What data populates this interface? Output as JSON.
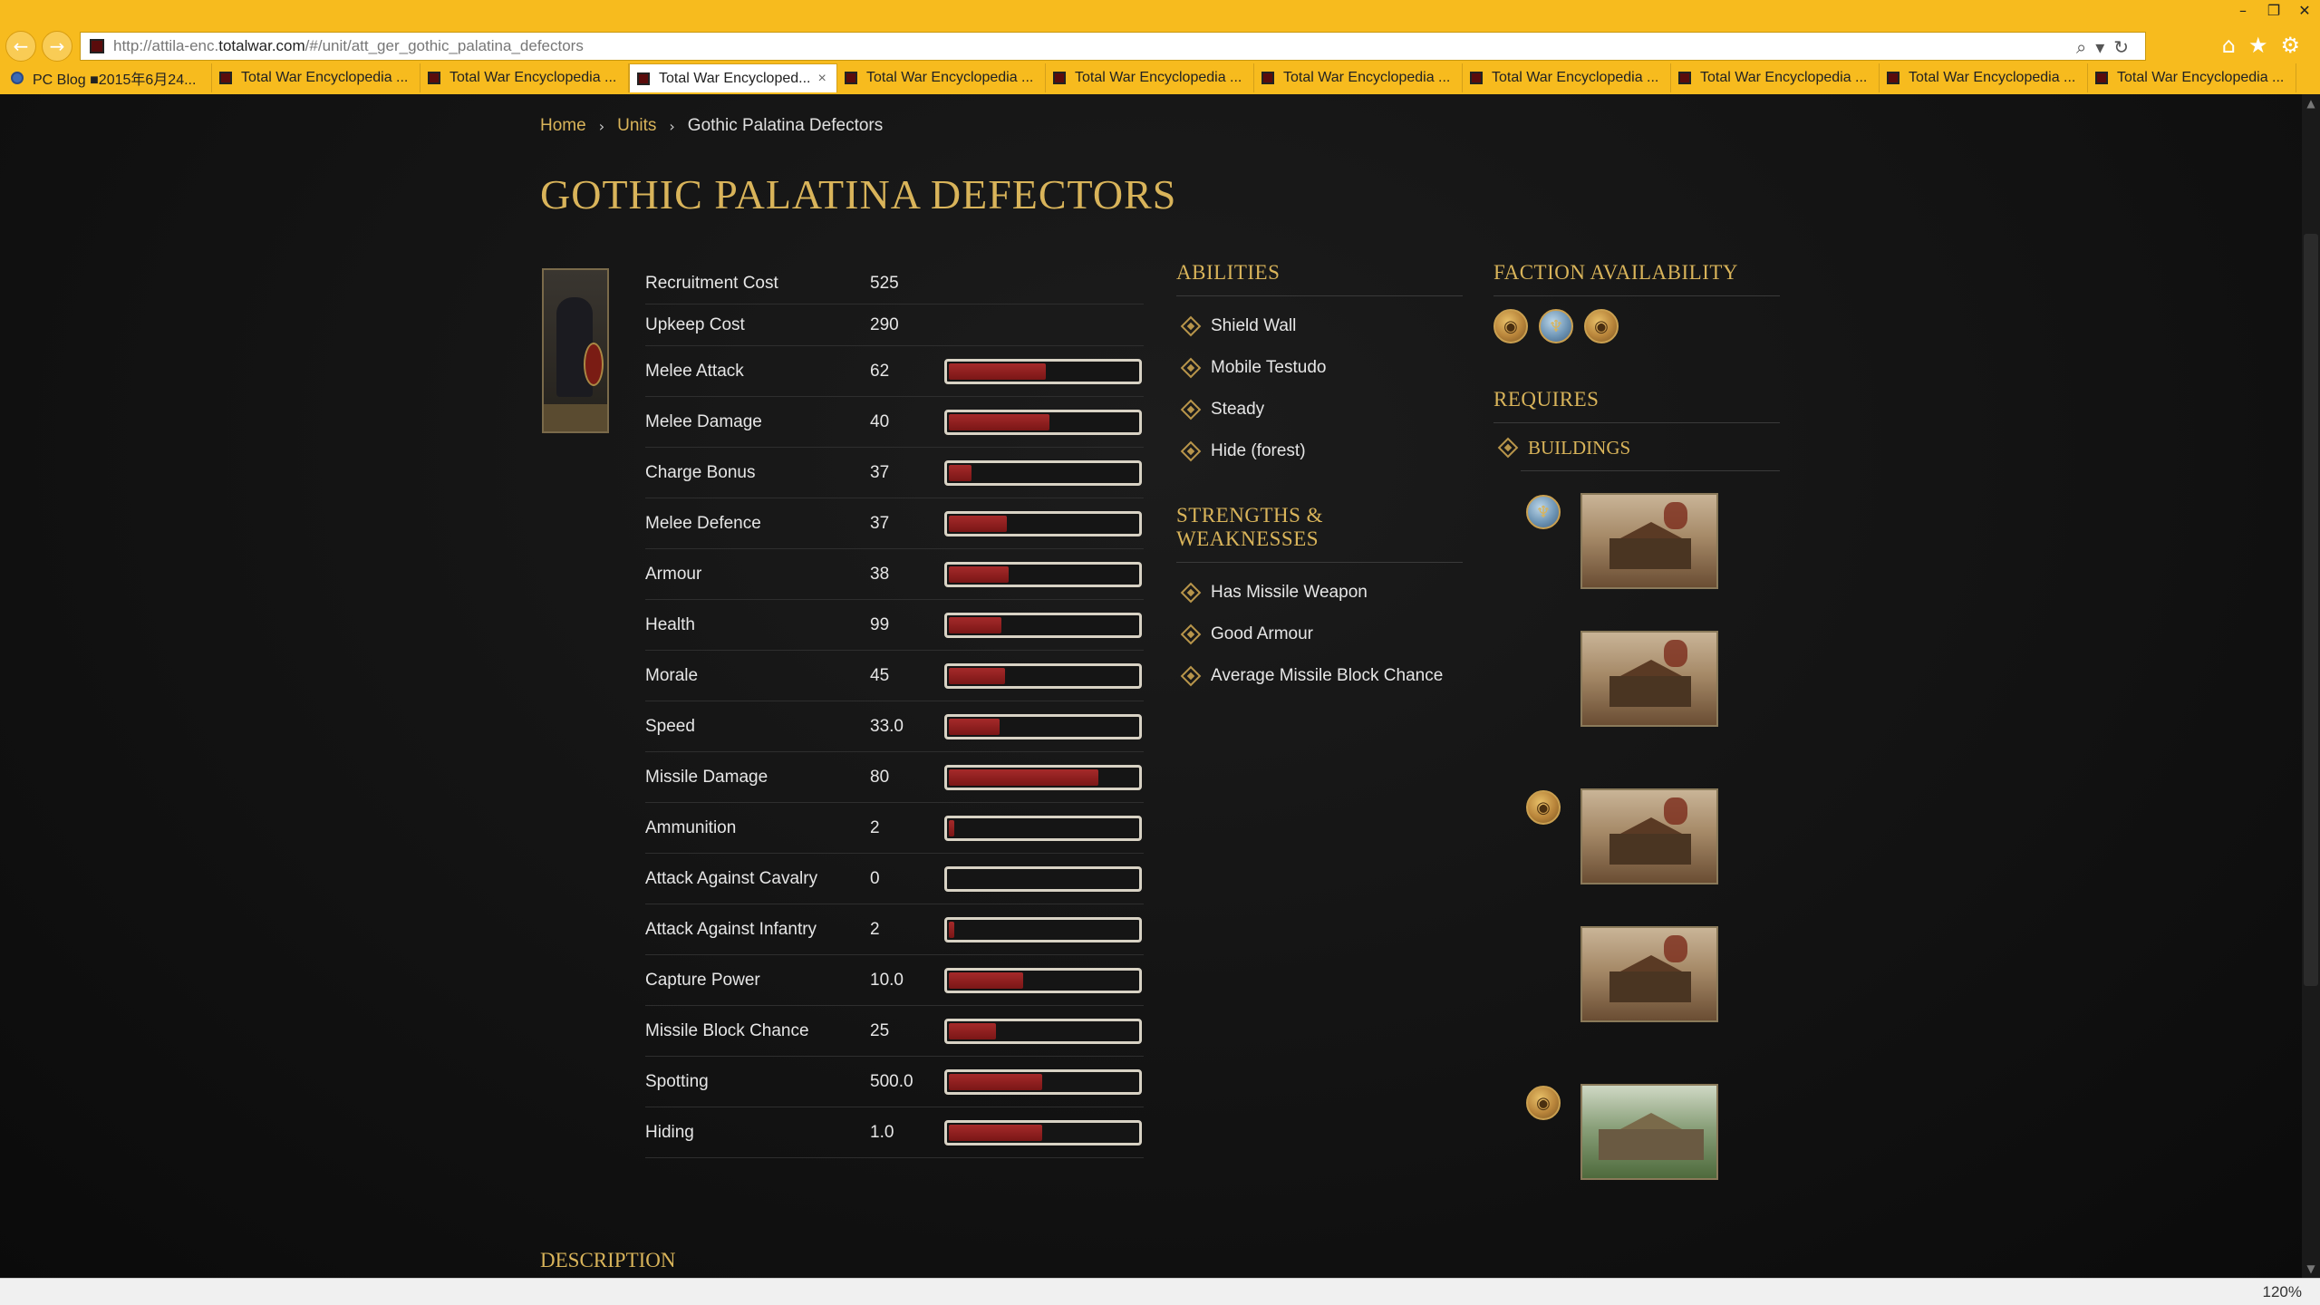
{
  "browser": {
    "url_prefix": "http://attila-enc.",
    "url_domain": "totalwar.com",
    "url_path": "/#/unit/att_ger_gothic_palatina_defectors",
    "zoom": "120%",
    "tabs": [
      {
        "label": "PC Blog ■2015年6月24..."
      },
      {
        "label": "Total War Encyclopedia ..."
      },
      {
        "label": "Total War Encyclopedia ..."
      },
      {
        "label": "Total War Encycloped..."
      },
      {
        "label": "Total War Encyclopedia ..."
      },
      {
        "label": "Total War Encyclopedia ..."
      },
      {
        "label": "Total War Encyclopedia ..."
      },
      {
        "label": "Total War Encyclopedia ..."
      },
      {
        "label": "Total War Encyclopedia ..."
      },
      {
        "label": "Total War Encyclopedia ..."
      },
      {
        "label": "Total War Encyclopedia ..."
      }
    ],
    "active_tab": 3
  },
  "breadcrumb": {
    "home": "Home",
    "units": "Units",
    "current": "Gothic Palatina Defectors"
  },
  "title": "GOTHIC PALATINA DEFECTORS",
  "stats": [
    {
      "label": "Recruitment Cost",
      "value": "525",
      "fill": null
    },
    {
      "label": "Upkeep Cost",
      "value": "290",
      "fill": null
    },
    {
      "label": "Melee Attack",
      "value": "62",
      "fill": 0.52
    },
    {
      "label": "Melee Damage",
      "value": "40",
      "fill": 0.54
    },
    {
      "label": "Charge Bonus",
      "value": "37",
      "fill": 0.12
    },
    {
      "label": "Melee Defence",
      "value": "37",
      "fill": 0.31
    },
    {
      "label": "Armour",
      "value": "38",
      "fill": 0.32
    },
    {
      "label": "Health",
      "value": "99",
      "fill": 0.28
    },
    {
      "label": "Morale",
      "value": "45",
      "fill": 0.3
    },
    {
      "label": "Speed",
      "value": "33.0",
      "fill": 0.27
    },
    {
      "label": "Missile Damage",
      "value": "80",
      "fill": 0.8
    },
    {
      "label": "Ammunition",
      "value": "2",
      "fill": 0.03
    },
    {
      "label": "Attack Against Cavalry",
      "value": "0",
      "fill": 0.0
    },
    {
      "label": "Attack Against Infantry",
      "value": "2",
      "fill": 0.03
    },
    {
      "label": "Capture Power",
      "value": "10.0",
      "fill": 0.4
    },
    {
      "label": "Missile Block Chance",
      "value": "25",
      "fill": 0.25
    },
    {
      "label": "Spotting",
      "value": "500.0",
      "fill": 0.5
    },
    {
      "label": "Hiding",
      "value": "1.0",
      "fill": 0.5
    }
  ],
  "abilities": {
    "title": "ABILITIES",
    "items": [
      "Shield Wall",
      "Mobile Testudo",
      "Steady",
      "Hide (forest)"
    ]
  },
  "strengths": {
    "title": "STRENGTHS & WEAKNESSES",
    "items": [
      "Has Missile Weapon",
      "Good Armour",
      "Average Missile Block Chance"
    ]
  },
  "faction": {
    "title": "FACTION AVAILABILITY",
    "icons": [
      "gold-coin-icon",
      "blue-faction-icon",
      "gold-coin-icon"
    ]
  },
  "requires": {
    "title": "REQUIRES",
    "buildings_label": "BUILDINGS"
  },
  "description_title": "DESCRIPTION"
}
